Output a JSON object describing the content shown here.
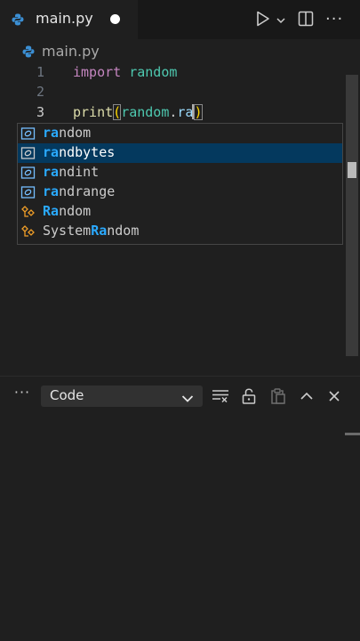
{
  "tab": {
    "label": "main.py",
    "dirty": true
  },
  "breadcrumb": {
    "label": "main.py"
  },
  "editor": {
    "line_numbers": [
      "1",
      "2",
      "3"
    ],
    "line1": {
      "keyword": "import",
      "module": "random"
    },
    "line3": {
      "fn": "print",
      "open": "(",
      "obj": "random",
      "dot": ".",
      "partial": "ra",
      "close": ")"
    }
  },
  "suggestions": [
    {
      "icon": "variable-icon",
      "match": "ra",
      "rest": "ndom",
      "selected": false
    },
    {
      "icon": "variable-icon",
      "match": "ra",
      "rest": "ndbytes",
      "selected": true
    },
    {
      "icon": "variable-icon",
      "match": "ra",
      "rest": "ndint",
      "selected": false
    },
    {
      "icon": "variable-icon",
      "match": "ra",
      "rest": "ndrange",
      "selected": false
    },
    {
      "icon": "class-icon",
      "prefix": "",
      "match": "Ra",
      "rest": "ndom",
      "selected": false
    },
    {
      "icon": "class-icon",
      "prefix": "System",
      "match": "Ra",
      "rest": "ndom",
      "selected": false
    }
  ],
  "panel": {
    "more": "···",
    "select_value": "Code"
  },
  "colors": {
    "match": "#2aaaff",
    "selected": "#04395e",
    "keyword": "#c586c0",
    "module": "#4ec9b0",
    "function": "#dcdcaa",
    "variable_icon": "#75beff",
    "class_icon": "#ee9d28"
  }
}
